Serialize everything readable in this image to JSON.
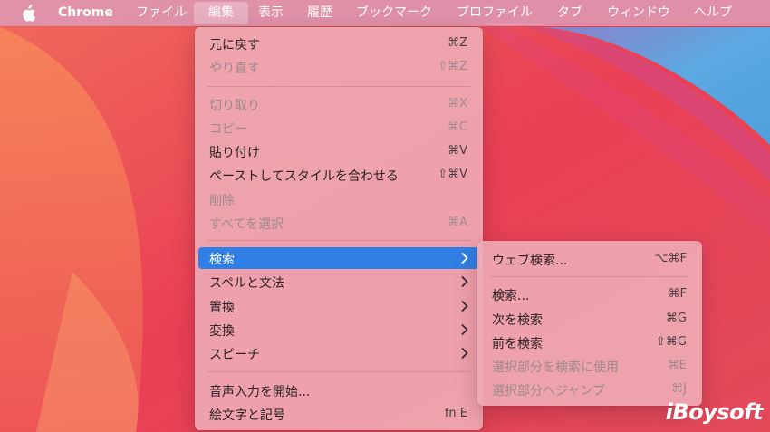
{
  "menubar": {
    "app_name": "Chrome",
    "items": [
      "ファイル",
      "編集",
      "表示",
      "履歴",
      "ブックマーク",
      "プロファイル",
      "タブ",
      "ウィンドウ",
      "ヘルプ"
    ],
    "active_item": "編集"
  },
  "edit_menu": {
    "items": [
      {
        "label": "元に戻す",
        "shortcut": "⌘Z"
      },
      {
        "label": "やり直す",
        "shortcut": "⇧⌘Z"
      },
      {
        "label": "切り取り",
        "shortcut": "⌘X"
      },
      {
        "label": "コピー",
        "shortcut": "⌘C"
      },
      {
        "label": "貼り付け",
        "shortcut": "⌘V"
      },
      {
        "label": "ペーストしてスタイルを合わせる",
        "shortcut": "⇧⌘V"
      },
      {
        "label": "削除",
        "shortcut": ""
      },
      {
        "label": "すべてを選択",
        "shortcut": "⌘A"
      },
      {
        "label": "検索"
      },
      {
        "label": "スペルと文法"
      },
      {
        "label": "置換"
      },
      {
        "label": "変換"
      },
      {
        "label": "スピーチ"
      },
      {
        "label": "音声入力を開始..."
      },
      {
        "label": "絵文字と記号",
        "shortcut": "fn E"
      }
    ]
  },
  "find_submenu": {
    "items": [
      {
        "label": "ウェブ検索...",
        "shortcut": "⌥⌘F"
      },
      {
        "label": "検索...",
        "shortcut": "⌘F"
      },
      {
        "label": "次を検索",
        "shortcut": "⌘G"
      },
      {
        "label": "前を検索",
        "shortcut": "⇧⌘G"
      },
      {
        "label": "選択部分を検索に使用",
        "shortcut": "⌘E"
      },
      {
        "label": "選択部分へジャンプ",
        "shortcut": "⌘J"
      }
    ]
  },
  "watermark": "iBoysoft",
  "icons": {
    "apple": "apple-logo-icon",
    "submenu_arrow": "chevron-right-icon"
  },
  "colors": {
    "highlight": "#2f7fe6",
    "wallpaper_base": "#e8434f",
    "wallpaper_accent": "#5aa6e0"
  }
}
